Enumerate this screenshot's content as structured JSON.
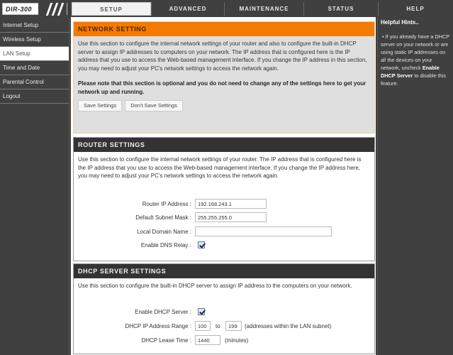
{
  "header": {
    "logo": "DIR-300",
    "tabs": [
      {
        "label": "SETUP",
        "active": true
      },
      {
        "label": "ADVANCED",
        "active": false
      },
      {
        "label": "MAINTENANCE",
        "active": false
      },
      {
        "label": "STATUS",
        "active": false
      },
      {
        "label": "HELP",
        "active": false
      }
    ]
  },
  "sidebar": {
    "items": [
      {
        "label": "Internet Setup",
        "active": false
      },
      {
        "label": "Wireless Setup",
        "active": false
      },
      {
        "label": "LAN Setup",
        "active": true
      },
      {
        "label": "Time and Date",
        "active": false
      },
      {
        "label": "Parental Control",
        "active": false
      },
      {
        "label": "Logout",
        "active": false
      }
    ]
  },
  "network_setting": {
    "title": "NETWORK SETTING",
    "description": "Use this section to configure the internal network settings of your router and also to configure the built-in DHCP server to assign IP addresses to computers on your network. The IP address that is configured here is the IP address that you use to access the Web-based management interface. If you change the IP address in this section, you may need to adjust your PC's network settings to access the network again.",
    "note": "Please note that this section is optional and you do not need to change any of the settings here to get your network up and running.",
    "save_label": "Save Settings",
    "dont_save_label": "Don't Save Settings"
  },
  "router_settings": {
    "title": "ROUTER SETTINGS",
    "description": "Use this section to configure the internal network settings of your router. The IP address that is configured here is the IP address that you use to access the Web-based management interface. If you change the IP address here, you may need to adjust your PC's network settings to access the network again.",
    "router_ip_label": "Router IP Address :",
    "router_ip_value": "192.168.243.1",
    "subnet_label": "Default Subnet Mask :",
    "subnet_value": "255.255.255.0",
    "domain_label": "Local Domain Name :",
    "domain_value": "",
    "dns_relay_label": "Enable DNS Relay :",
    "dns_relay_checked": true
  },
  "dhcp_settings": {
    "title": "DHCP SERVER SETTINGS",
    "description": "Use this section to configure the built-in DHCP server to assign IP address to the computers on your network.",
    "enable_label": "Enable DHCP Server :",
    "enable_checked": true,
    "range_label": "DHCP IP Address Range :",
    "range_start": "100",
    "range_to": "to",
    "range_end": "199",
    "range_note": "(addresses within the LAN subnet)",
    "lease_label": "DHCP Lease Time :",
    "lease_value": "1440",
    "lease_unit": "(minutes)"
  },
  "help": {
    "title": "Helpful Hints..",
    "bullet": "•",
    "text_before": "If you already have a DHCP server on your network or are using static IP addresses on all the devices on your network, uncheck",
    "text_bold": "Enable DHCP Server",
    "text_after": "to disable this feature."
  }
}
